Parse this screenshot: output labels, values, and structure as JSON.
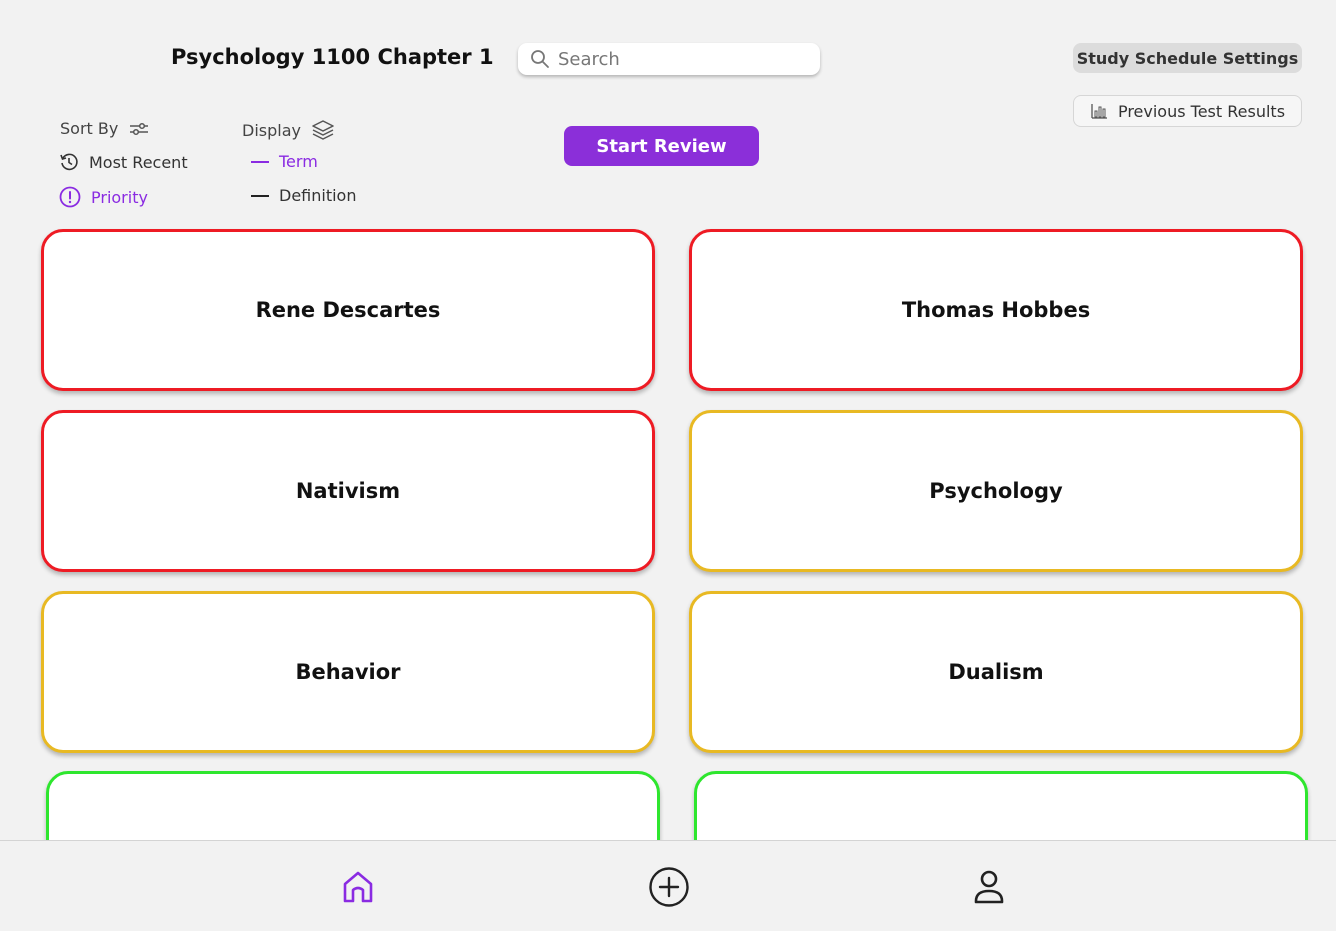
{
  "header": {
    "title": "Psychology 1100 Chapter 1",
    "search_placeholder": "Search",
    "schedule_button": "Study Schedule Settings",
    "results_button": "Previous Test Results",
    "start_button": "Start Review"
  },
  "sort": {
    "label": "Sort By",
    "options": [
      {
        "label": "Most Recent",
        "active": false
      },
      {
        "label": "Priority",
        "active": true
      }
    ]
  },
  "display": {
    "label": "Display",
    "options": [
      {
        "label": "Term",
        "active": true
      },
      {
        "label": "Definition",
        "active": false
      }
    ]
  },
  "colors": {
    "accent": "#8b2fd9",
    "priority_high": "#ee1b24",
    "priority_medium": "#e8b923",
    "priority_low": "#2ee62e"
  },
  "cards": [
    {
      "term": "Rene Descartes",
      "priority": "high"
    },
    {
      "term": "Thomas Hobbes",
      "priority": "high"
    },
    {
      "term": "Nativism",
      "priority": "high"
    },
    {
      "term": "Psychology",
      "priority": "medium"
    },
    {
      "term": "Behavior",
      "priority": "medium"
    },
    {
      "term": "Dualism",
      "priority": "medium"
    },
    {
      "term": "",
      "priority": "low"
    },
    {
      "term": "",
      "priority": "low"
    }
  ],
  "nav": {
    "items": [
      {
        "icon": "home-icon",
        "active": true
      },
      {
        "icon": "add-icon",
        "active": false
      },
      {
        "icon": "profile-icon",
        "active": false
      }
    ]
  }
}
